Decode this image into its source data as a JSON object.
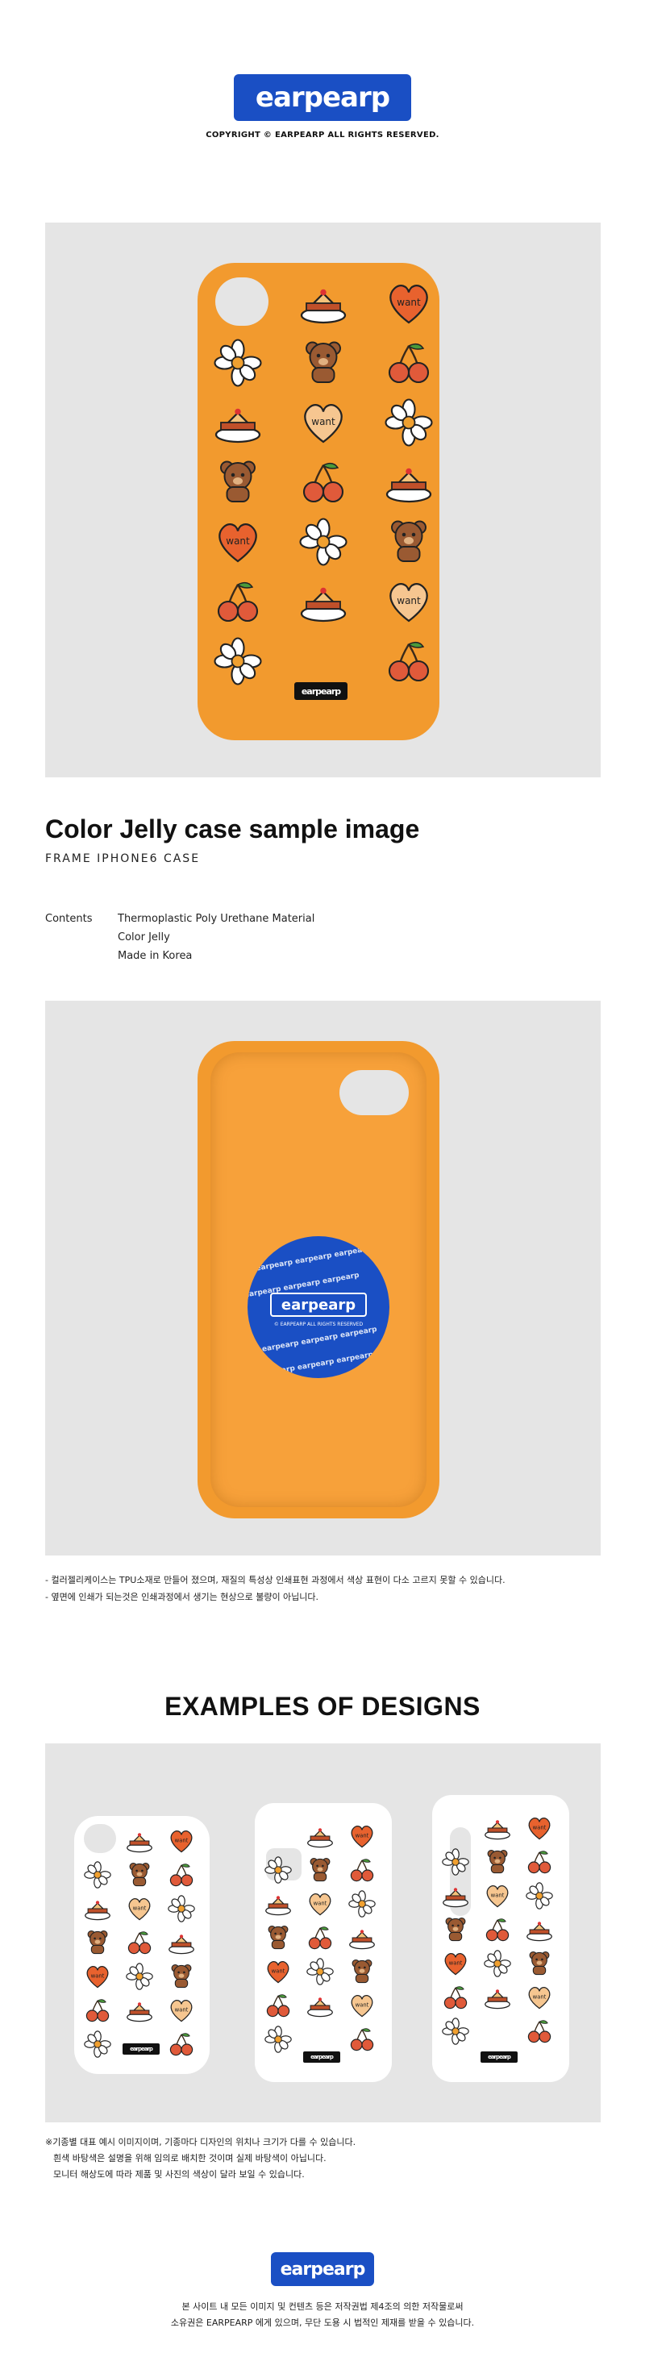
{
  "header": {
    "logo_text": "earpearp",
    "copyright": "COPYRIGHT © EARPEARP ALL RIGHTS RESERVED."
  },
  "product": {
    "title": "Color Jelly case sample image",
    "subtitle": "FRAME IPHONE6 CASE",
    "case_logo": "earpearp",
    "heart_text": "want",
    "inner_sticker_text": "earpearp",
    "inner_sticker_copyright": "© EARPEARP ALL RIGHTS RESERVED"
  },
  "contents": {
    "label": "Contents",
    "lines": [
      "Thermoplastic Poly Urethane Material",
      "Color Jelly",
      "Made in Korea"
    ]
  },
  "notes": [
    "- 컬러젤리케이스는 TPU소재로 만들어 졌으며, 재질의 특성상 인쇄표현 과정에서 색상 표현이 다소 고르지 못할 수 있습니다.",
    "- 옆면에 인쇄가 되는것은 인쇄과정에서 생기는 현상으로 불량이 아닙니다."
  ],
  "examples": {
    "title": "EXAMPLES OF DESIGNS",
    "notes": [
      "※기종별 대표 예시 이미지이며, 기종마다 디자인의 위치나 크기가 다를 수 있습니다.",
      "흰색 바탕색은 설명을 위해 임의로 배치한 것이며 실제 바탕색이 아닙니다.",
      "모니터 해상도에 따라 제품 및 사진의 색상이 달라 보일 수 있습니다."
    ]
  },
  "footer": {
    "logo_text": "earpearp",
    "line1": "본 사이트 내 모든 이미지 및 컨텐츠 등은 저작권법 제4조의 의한 저작물로써",
    "line2": "소유권은 EARPEARP 에게 있으며, 무단 도용 시 법적인 제재를 받을 수 있습니다."
  },
  "colors": {
    "brand_blue": "#1a4fc4",
    "case_orange": "#f29a2e",
    "panel_gray": "#e5e5e5"
  },
  "icons": [
    "cake-icon",
    "heart-icon",
    "flower-icon",
    "bear-icon",
    "cherry-icon"
  ]
}
